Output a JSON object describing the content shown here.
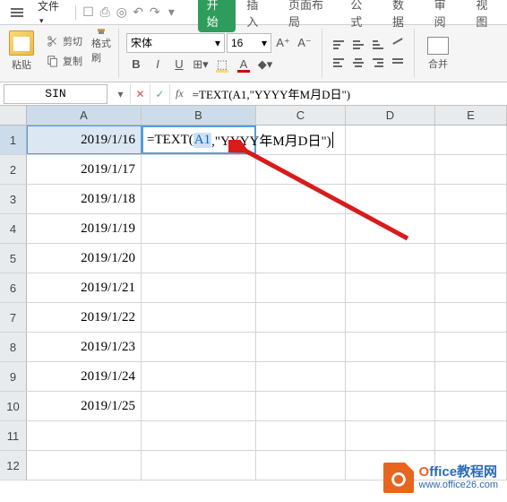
{
  "menubar": {
    "file_label": "文件",
    "tabs": [
      "开始",
      "插入",
      "页面布局",
      "公式",
      "数据",
      "审阅",
      "视图"
    ],
    "active_tab": 0
  },
  "ribbon": {
    "paste_label": "粘贴",
    "cut_label": "剪切",
    "copy_label": "复制",
    "format_painter_label": "格式刷",
    "font_name": "宋体",
    "font_size": "16",
    "merge_label": "合并"
  },
  "formula_bar": {
    "name_box": "SIN",
    "formula": "=TEXT(A1,\"YYYY年M月D日\")"
  },
  "columns": [
    "A",
    "B",
    "C",
    "D",
    "E"
  ],
  "rows": [
    {
      "n": "1",
      "a": "2019/1/16"
    },
    {
      "n": "2",
      "a": "2019/1/17"
    },
    {
      "n": "3",
      "a": "2019/1/18"
    },
    {
      "n": "4",
      "a": "2019/1/19"
    },
    {
      "n": "5",
      "a": "2019/1/20"
    },
    {
      "n": "6",
      "a": "2019/1/21"
    },
    {
      "n": "7",
      "a": "2019/1/22"
    },
    {
      "n": "8",
      "a": "2019/1/23"
    },
    {
      "n": "9",
      "a": "2019/1/24"
    },
    {
      "n": "10",
      "a": "2019/1/25"
    },
    {
      "n": "11",
      "a": ""
    },
    {
      "n": "12",
      "a": ""
    }
  ],
  "editing_cell": {
    "prefix": "=TEXT(",
    "ref": "A1",
    "suffix": ",\"YYYY年M月D日\")"
  },
  "watermark": {
    "line1_orange": "O",
    "line1_blue": "ffice教程网",
    "line2": "www.office26.com"
  }
}
